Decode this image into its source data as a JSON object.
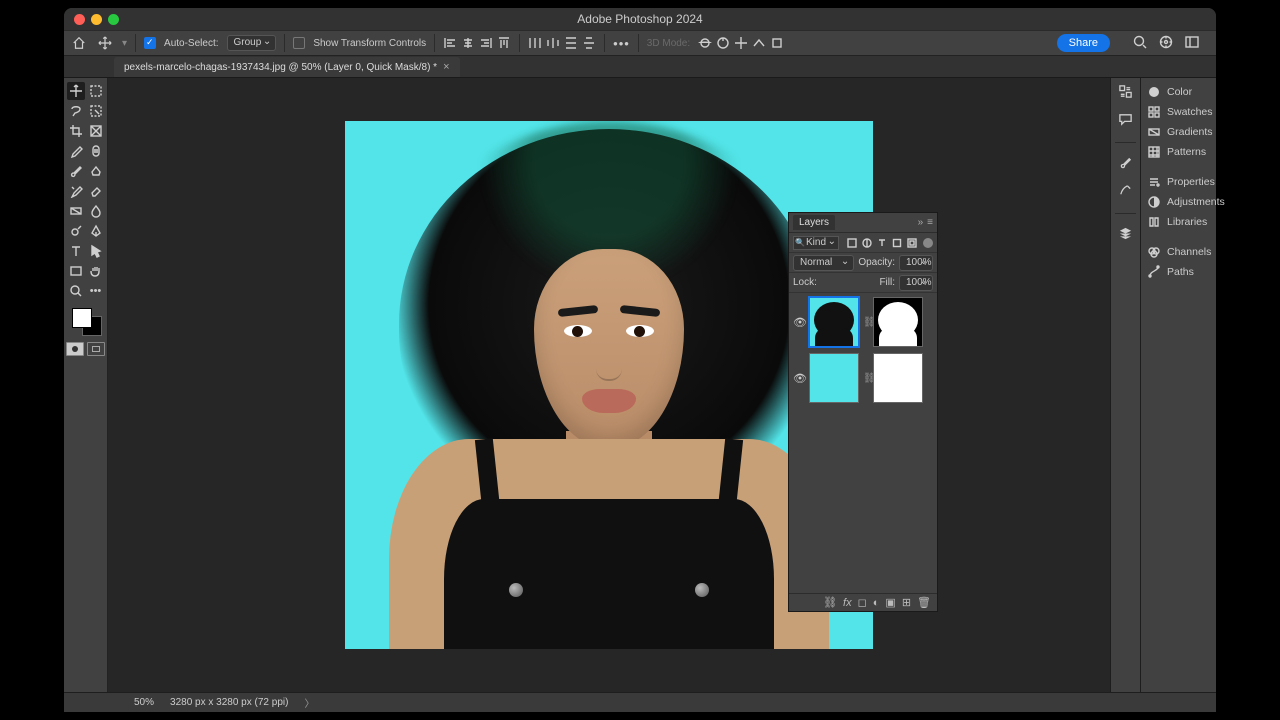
{
  "titlebar": {
    "app_title": "Adobe Photoshop 2024"
  },
  "options": {
    "auto_select_label": "Auto-Select:",
    "auto_select_target": "Group",
    "show_transform_label": "Show Transform Controls",
    "mode_label": "3D Mode:"
  },
  "share_label": "Share",
  "document_tab": {
    "title": "pexels-marcelo-chagas-1937434.jpg @ 50% (Layer 0, Quick Mask/8) *"
  },
  "layers_panel": {
    "tab_label": "Layers",
    "filter_kind": "Kind",
    "blend_mode": "Normal",
    "opacity_label": "Opacity:",
    "opacity_value": "100%",
    "lock_label": "Lock:",
    "fill_label": "Fill:",
    "fill_value": "100%"
  },
  "right_rail": {
    "color": "Color",
    "swatches": "Swatches",
    "gradients": "Gradients",
    "patterns": "Patterns",
    "properties": "Properties",
    "adjustments": "Adjustments",
    "libraries": "Libraries",
    "channels": "Channels",
    "paths": "Paths"
  },
  "statusbar": {
    "zoom": "50%",
    "doc_info": "3280 px x 3280 px (72 ppi)"
  }
}
